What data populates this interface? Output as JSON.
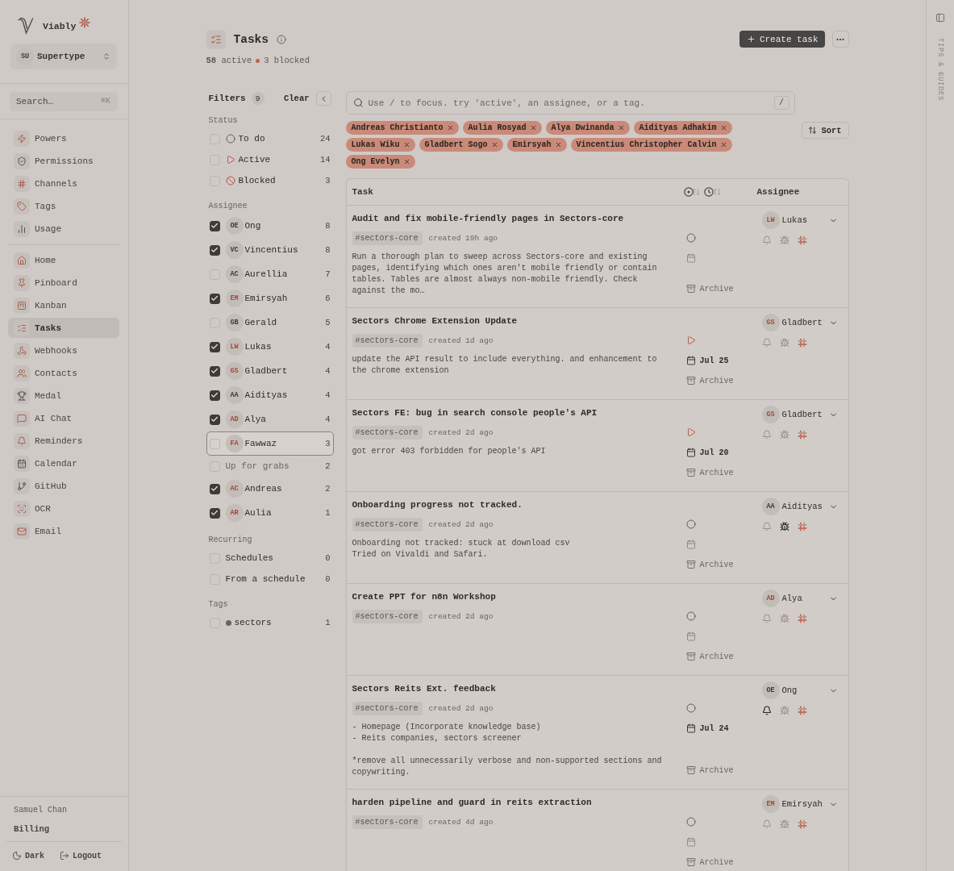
{
  "sidebar": {
    "brand": "Viably",
    "workspace": {
      "initials": "SU",
      "name": "Supertype"
    },
    "search": {
      "placeholder": "Search…",
      "shortcut": "⌘K"
    },
    "nav_groups": [
      {
        "items": [
          {
            "label": "Powers",
            "selected": false
          },
          {
            "label": "Permissions",
            "selected": false
          },
          {
            "label": "Channels",
            "selected": false
          },
          {
            "label": "Tags",
            "selected": false
          },
          {
            "label": "Usage",
            "selected": false
          }
        ]
      },
      {
        "items": [
          {
            "label": "Home",
            "selected": false
          },
          {
            "label": "Pinboard",
            "selected": false
          },
          {
            "label": "Kanban",
            "selected": false
          },
          {
            "label": "Tasks",
            "selected": true
          },
          {
            "label": "Webhooks",
            "selected": false
          },
          {
            "label": "Contacts",
            "selected": false
          },
          {
            "label": "Medal",
            "selected": false
          },
          {
            "label": "AI Chat",
            "selected": false
          },
          {
            "label": "Reminders",
            "selected": false
          },
          {
            "label": "Calendar",
            "selected": false
          },
          {
            "label": "GitHub",
            "selected": false
          },
          {
            "label": "OCR",
            "selected": false
          },
          {
            "label": "Email",
            "selected": false
          }
        ]
      }
    ],
    "user": {
      "name": "Samuel Chan",
      "billing": "Billing"
    },
    "footer": {
      "theme": "Dark",
      "logout": "Logout"
    }
  },
  "header": {
    "title": "Tasks",
    "active": "**58** active",
    "blocked": "3 blocked",
    "create_button": "Create task"
  },
  "filters": {
    "title": "Filters",
    "count": "9",
    "clear": "Clear",
    "groups": [
      {
        "label": "Status",
        "options": [
          {
            "kind": "todo",
            "label": "To do",
            "count": "24",
            "checked": false,
            "highlighted": false
          },
          {
            "kind": "active",
            "label": "Active",
            "count": "14",
            "checked": false,
            "highlighted": false
          },
          {
            "kind": "blocked",
            "label": "Blocked",
            "count": "3",
            "checked": false,
            "highlighted": false
          }
        ]
      },
      {
        "label": "Assignee",
        "options": [
          {
            "kind": "person",
            "initials": "OE",
            "color": "#3d3836",
            "label": "Ong",
            "count": "8",
            "checked": true,
            "highlighted": false
          },
          {
            "kind": "person",
            "initials": "VC",
            "color": "#3d3836",
            "label": "Vincentius",
            "count": "8",
            "checked": true,
            "highlighted": false
          },
          {
            "kind": "person",
            "initials": "AC",
            "color": "#3d3836",
            "label": "Aurellia",
            "count": "7",
            "checked": false,
            "highlighted": false
          },
          {
            "kind": "person",
            "initials": "EM",
            "color": "#a4483a",
            "label": "Emirsyah",
            "count": "6",
            "checked": true,
            "highlighted": false
          },
          {
            "kind": "person",
            "initials": "GB",
            "color": "#3d3836",
            "label": "Gerald",
            "count": "5",
            "checked": false,
            "highlighted": false
          },
          {
            "kind": "person",
            "initials": "LW",
            "color": "#a4483a",
            "label": "Lukas",
            "count": "4",
            "checked": true,
            "highlighted": false
          },
          {
            "kind": "person",
            "initials": "GS",
            "color": "#a4483a",
            "label": "Gladbert",
            "count": "4",
            "checked": true,
            "highlighted": false
          },
          {
            "kind": "person",
            "initials": "AA",
            "color": "#3d3836",
            "label": "Aidityas",
            "count": "4",
            "checked": true,
            "highlighted": false
          },
          {
            "kind": "person",
            "initials": "AD",
            "color": "#a4483a",
            "label": "Alya",
            "count": "4",
            "checked": true,
            "highlighted": false
          },
          {
            "kind": "person",
            "initials": "FA",
            "color": "#a4483a",
            "label": "Fawwaz",
            "count": "3",
            "checked": false,
            "highlighted": true
          },
          {
            "kind": "unassigned",
            "label": "Up for grabs",
            "count": "2",
            "checked": false,
            "highlighted": false
          },
          {
            "kind": "person",
            "initials": "AC",
            "color": "#a4483a",
            "label": "Andreas",
            "count": "2",
            "checked": true,
            "highlighted": false
          },
          {
            "kind": "person",
            "initials": "AR",
            "color": "#a4483a",
            "label": "Aulia",
            "count": "1",
            "checked": true,
            "highlighted": false
          }
        ]
      },
      {
        "label": "Recurring",
        "options": [
          {
            "kind": "plain",
            "label": "Schedules",
            "count": "0",
            "checked": false,
            "highlighted": false
          },
          {
            "kind": "plain",
            "label": "From a schedule",
            "count": "0",
            "checked": false,
            "highlighted": false
          }
        ]
      },
      {
        "label": "Tags",
        "options": [
          {
            "kind": "tag",
            "label": "sectors",
            "count": "1",
            "checked": false,
            "highlighted": false
          }
        ]
      }
    ]
  },
  "search": {
    "placeholder": "Use / to focus. try 'active', an assignee, or a tag.",
    "shortcut": "/"
  },
  "chips": [
    "Andreas Christianto",
    "Aulia Rosyad",
    "Alya Dwinanda",
    "Aidityas Adhakim",
    "Lukas Wiku",
    "Gladbert Sogo",
    "Emirsyah",
    "Vincentius Christopher Calvin",
    "Ong Evelyn"
  ],
  "sort": "Sort",
  "table": {
    "task_column": "Task",
    "assignee_column": "Assignee",
    "tasks": [
      {
        "kind": "todo",
        "title": "Audit and fix mobile-friendly pages in Sectors-core",
        "tag": "#sectors-core",
        "created": "created 19h ago",
        "description": "Run a thorough plan to sweep across Sectors-core and existing pages, identifying which ones aren't mobile friendly or contain tables. Tables are almost always non-mobile friendly. Check against the mo…",
        "archive": "Archive",
        "assignee": {
          "initials": "LW",
          "name": "Lukas",
          "color": "#a4483a"
        },
        "bell_on": false,
        "bug_on": false
      },
      {
        "kind": "active",
        "title": "Sectors Chrome Extension Update",
        "tag": "#sectors-core",
        "created": "created 1d ago",
        "description": "update the API result to include everything. and enhancement to the chrome extension",
        "due": "Jul 25",
        "archive": "Archive",
        "assignee": {
          "initials": "GS",
          "name": "Gladbert",
          "color": "#a4483a"
        },
        "bell_on": false,
        "bug_on": false
      },
      {
        "kind": "active",
        "title": "Sectors FE: bug in search console people's API",
        "tag": "#sectors-core",
        "created": "created 2d ago",
        "description": "got error 403 forbidden for people's API",
        "due": "Jul 20",
        "archive": "Archive",
        "assignee": {
          "initials": "GS",
          "name": "Gladbert",
          "color": "#a4483a"
        },
        "bell_on": false,
        "bug_on": false
      },
      {
        "kind": "todo",
        "title": "Onboarding progress not tracked.",
        "tag": "#sectors-core",
        "created": "created 2d ago",
        "description": "Onboarding not tracked: stuck at download csv\nTried on Vivaldi and Safari.",
        "archive": "Archive",
        "assignee": {
          "initials": "AA",
          "name": "Aidityas",
          "color": "#3d3836"
        },
        "bell_on": false,
        "bug_on": true
      },
      {
        "kind": "todo",
        "title": "Create PPT for n8n Workshop",
        "tag": "#sectors-core",
        "created": "created 2d ago",
        "archive": "Archive",
        "assignee": {
          "initials": "AD",
          "name": "Alya",
          "color": "#a4483a"
        },
        "bell_on": false,
        "bug_on": false
      },
      {
        "kind": "todo",
        "title": "Sectors Reits Ext. feedback",
        "tag": "#sectors-core",
        "created": "created 2d ago",
        "description": "- Homepage (Incorporate knowledge base)\n- Reits companies, sectors screener\n\n*remove all unnecessarily verbose and non-supported sections and copywriting.",
        "due": "Jul 24",
        "archive": "Archive",
        "assignee": {
          "initials": "OE",
          "name": "Ong",
          "color": "#3d3836"
        },
        "bell_on": true,
        "bug_on": false
      },
      {
        "kind": "todo",
        "title": "harden pipeline and guard in reits extraction",
        "tag": "#sectors-core",
        "created": "created 4d ago",
        "archive": "Archive",
        "assignee": {
          "initials": "EM",
          "name": "Emirsyah",
          "color": "#a4483a"
        },
        "bell_on": false,
        "bug_on": false
      }
    ]
  },
  "tips": "TIPS & GUIDES"
}
